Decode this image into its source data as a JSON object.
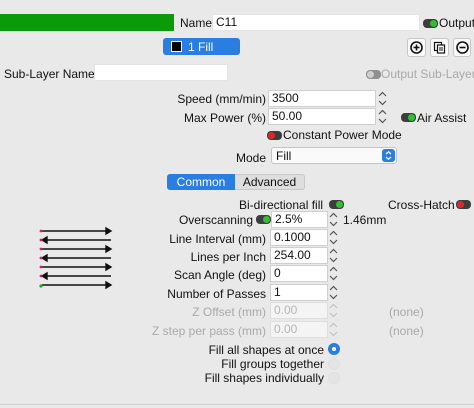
{
  "header": {
    "layer_color": "#0a9a0a",
    "name_label": "Name",
    "name_value": "C11",
    "output_label": "Output"
  },
  "layer_chip": {
    "label": "1 Fill",
    "swatch_color": "#000000",
    "bg_color": "#2a7de1"
  },
  "toolbar": {
    "add_icon": "plus-circle-icon",
    "copy_icon": "copy-icon",
    "remove_icon": "minus-circle-icon"
  },
  "sublayer": {
    "label": "Sub-Layer Name",
    "value": "",
    "output_label": "Output Sub-Layer"
  },
  "speed": {
    "label": "Speed (mm/min)",
    "value": "3500"
  },
  "max_power": {
    "label": "Max Power (%)",
    "value": "50.00"
  },
  "air_assist": {
    "label": "Air Assist",
    "on": true
  },
  "constant_power": {
    "label": "Constant Power Mode",
    "on": false
  },
  "mode": {
    "label": "Mode",
    "value": "Fill"
  },
  "tabs": {
    "common": "Common",
    "advanced": "Advanced",
    "active": "common"
  },
  "bidirectional": {
    "label": "Bi-directional fill",
    "on": true
  },
  "cross_hatch": {
    "label": "Cross-Hatch",
    "on": false
  },
  "overscanning": {
    "label": "Overscanning",
    "value": "2.5%",
    "computed": "1.46mm",
    "on": true
  },
  "line_interval": {
    "label": "Line Interval (mm)",
    "value": "0.1000"
  },
  "lines_per_inch": {
    "label": "Lines per Inch",
    "value": "254.00"
  },
  "scan_angle": {
    "label": "Scan Angle (deg)",
    "value": "0"
  },
  "passes": {
    "label": "Number of Passes",
    "value": "1"
  },
  "z_offset": {
    "label": "Z Offset (mm)",
    "value": "0.00",
    "note": "(none)"
  },
  "z_step": {
    "label": "Z step per pass (mm)",
    "value": "0.00",
    "note": "(none)"
  },
  "fill_options": {
    "all_at_once": "Fill all shapes at once",
    "groups_together": "Fill groups together",
    "individually": "Fill shapes individually",
    "selected": "all_at_once"
  },
  "colors": {
    "accent": "#2a7de1",
    "toggle_on": "#2fc12f",
    "toggle_off": "#d62b2b",
    "preview_arrow": "#111111",
    "preview_dot_left": "#d81b6e",
    "preview_dot_green": "#1ab01a"
  }
}
